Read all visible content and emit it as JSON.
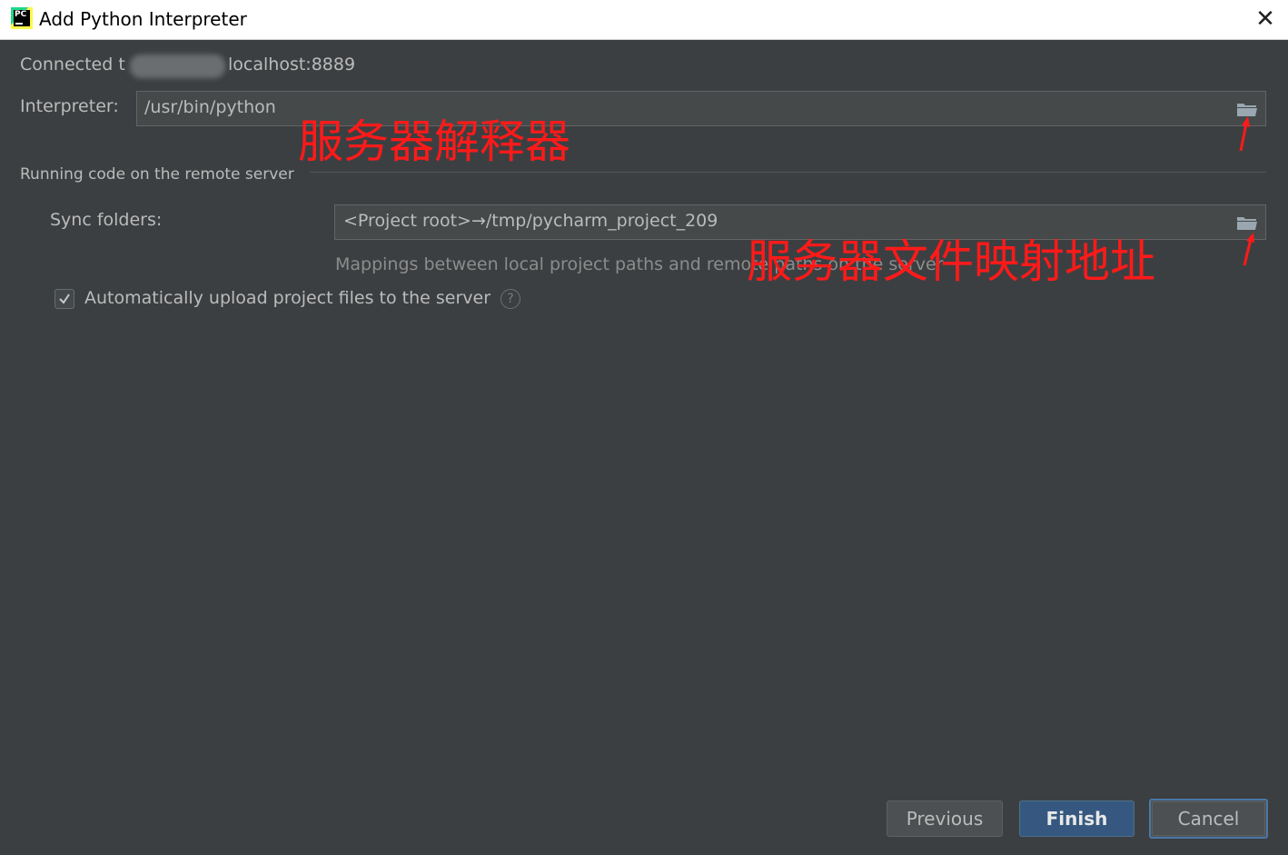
{
  "window": {
    "title": "Add Python Interpreter",
    "close_glyph": "✕"
  },
  "connection": {
    "prefix": "Connected t",
    "host": "localhost:8889"
  },
  "interpreter": {
    "label": "Interpreter:",
    "value": "/usr/bin/python"
  },
  "remote_section": {
    "title": "Running code on the remote server",
    "sync_label": "Sync folders:",
    "sync_value": "<Project root>→/tmp/pycharm_project_209",
    "hint": "Mappings between local project paths and remote paths on the server",
    "auto_upload_label": "Automatically upload project files to the server",
    "auto_upload_checked": true,
    "help_glyph": "?"
  },
  "annotations": {
    "interpreter_note": "服务器解释器",
    "sync_note": "服务器文件映射地址",
    "color": "#ff1a1a"
  },
  "buttons": {
    "previous": "Previous",
    "finish": "Finish",
    "cancel": "Cancel"
  },
  "icons": [
    "pycharm-app-icon",
    "close-icon",
    "folder-icon",
    "checkmark-icon",
    "help-icon",
    "arrow-icon"
  ]
}
